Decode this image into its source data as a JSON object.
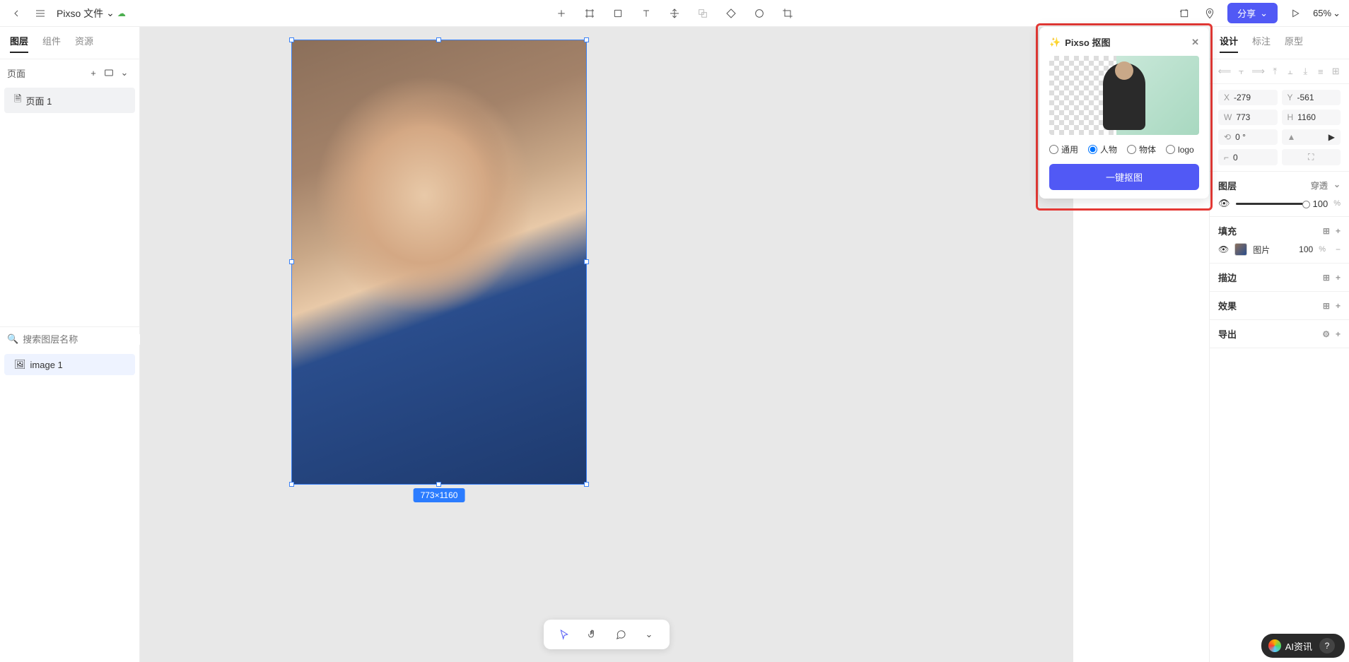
{
  "header": {
    "filename": "Pixso 文件",
    "share_label": "分享",
    "zoom": "65%"
  },
  "left_panel": {
    "tabs": [
      "图层",
      "组件",
      "资源"
    ],
    "active_tab": 0,
    "pages_label": "页面",
    "pages": [
      "页面 1"
    ],
    "search_placeholder": "搜索图层名称",
    "layers": [
      "image 1"
    ]
  },
  "canvas": {
    "dim_label": "773×1160"
  },
  "popup": {
    "title": "Pixso 抠图",
    "options": [
      "通用",
      "人物",
      "物体",
      "logo"
    ],
    "selected": 1,
    "action_label": "一键抠图"
  },
  "right_panel": {
    "tabs": [
      "设计",
      "标注",
      "原型"
    ],
    "active_tab": 0,
    "props": {
      "X": "-279",
      "Y": "-561",
      "W": "773",
      "H": "1160",
      "rotation": "0 °",
      "radius": "0"
    },
    "sections": {
      "layer": {
        "title": "图层",
        "mode": "穿透",
        "opacity": "100"
      },
      "fill": {
        "title": "填充",
        "type": "图片",
        "opacity": "100"
      },
      "stroke": {
        "title": "描边"
      },
      "effect": {
        "title": "效果"
      },
      "export": {
        "title": "导出"
      }
    }
  },
  "float_tb": {},
  "watermark": "AI资讯"
}
